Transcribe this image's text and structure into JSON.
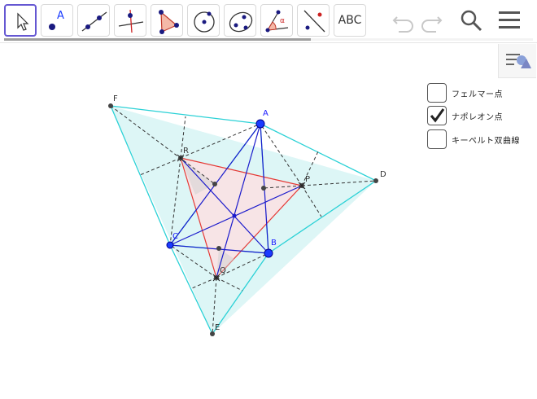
{
  "toolbar": {
    "tools": [
      {
        "name": "move-tool"
      },
      {
        "name": "point-tool",
        "glyph": "A"
      },
      {
        "name": "line-tool"
      },
      {
        "name": "perpendicular-line-tool"
      },
      {
        "name": "polygon-tool"
      },
      {
        "name": "circle-tool"
      },
      {
        "name": "conic-tool"
      },
      {
        "name": "angle-tool",
        "glyph": "α"
      },
      {
        "name": "reflect-tool"
      },
      {
        "name": "text-tool",
        "label": "ABC"
      }
    ],
    "actions": [
      "undo-icon",
      "redo-icon",
      "search-icon",
      "menu-icon"
    ],
    "progress": 0.58
  },
  "checkboxes": [
    {
      "label": "フェルマー点",
      "checked": false
    },
    {
      "label": "ナポレオン点",
      "checked": true
    },
    {
      "label": "キーペルト双曲線",
      "checked": false
    }
  ],
  "points": {
    "A": "A",
    "B": "B",
    "C": "C",
    "D": "D",
    "E": "E",
    "F": "F",
    "P": "P",
    "Q": "Q",
    "R": "R"
  },
  "colors": {
    "accent": "#6557d2",
    "outer_triangle_fill": "#d6f5f5",
    "outer_triangle_edge": "#22d3d3",
    "napoleon_fill": "#fbe2e2",
    "napoleon_edge": "#e53935",
    "main_triangle_edge": "#1a1acc",
    "point_blue": "#1a3cff",
    "point_dark": "#444444"
  }
}
